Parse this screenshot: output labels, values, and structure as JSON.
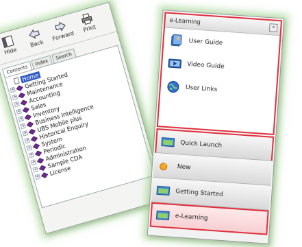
{
  "help_window": {
    "toolbar": [
      {
        "label": "Hide",
        "icon": "hide-icon"
      },
      {
        "label": "Back",
        "icon": "back-arrow-icon"
      },
      {
        "label": "Forward",
        "icon": "forward-arrow-icon"
      },
      {
        "label": "Print",
        "icon": "print-icon"
      }
    ],
    "tabs": [
      {
        "label": "Contents",
        "active": true
      },
      {
        "label": "Index",
        "active": false
      },
      {
        "label": "Search",
        "active": false
      }
    ],
    "tree": {
      "home": "Home",
      "items": [
        "Getting Started",
        "Maintenance",
        "Accounting",
        "Sales",
        "Inventory",
        "Business Intelligence",
        "UBS Mobile plus",
        "Historical Enquiry",
        "System",
        "Periodic",
        "Administration",
        "Sample CDA",
        "License"
      ]
    }
  },
  "nav_panel": {
    "header": {
      "title": "e-Learning",
      "collapse_glyph": "«"
    },
    "elearning_items": [
      {
        "label": "User Guide",
        "icon": "user-guide-icon"
      },
      {
        "label": "Video Guide",
        "icon": "video-guide-icon"
      },
      {
        "label": "User Links",
        "icon": "globe-icon"
      }
    ],
    "buttons": [
      {
        "label": "Quick Launch",
        "icon": "quick-launch-icon"
      },
      {
        "label": "New",
        "icon": "new-icon"
      },
      {
        "label": "Getting Started",
        "icon": "getting-started-icon"
      },
      {
        "label": "e-Learning",
        "icon": "elearning-icon"
      }
    ]
  },
  "colors": {
    "highlight_red": "#e0303c",
    "glow_green": "#8cc878",
    "tree_book_purple": "#6a2a8a",
    "selection_blue": "#2e58c4"
  }
}
